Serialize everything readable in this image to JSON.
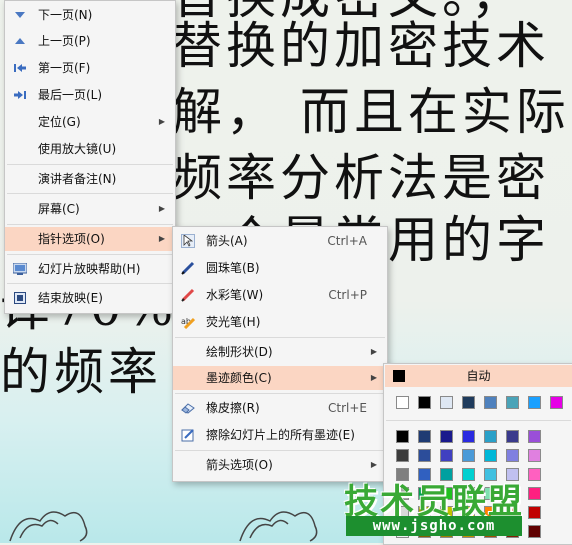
{
  "slide": {
    "lines": [
      "替换成密文。，",
      "替换的加密技术",
      "解， 而且在实际",
      "频率分析法是密",
      "一个最常用的字",
      "译70%    最现代",
      "的频率      根据统"
    ]
  },
  "main_menu": {
    "items": [
      {
        "label": "下一页(N)",
        "icon": "triangle-down-icon"
      },
      {
        "label": "上一页(P)",
        "icon": "triangle-up-icon"
      },
      {
        "label": "第一页(F)",
        "icon": "first-page-icon"
      },
      {
        "label": "最后一页(L)",
        "icon": "last-page-icon"
      },
      {
        "label": "定位(G)",
        "submenu": true
      },
      {
        "label": "使用放大镜(U)"
      },
      {
        "label": "演讲者备注(N)"
      },
      {
        "label": "屏幕(C)",
        "submenu": true
      },
      {
        "label": "指针选项(O)",
        "submenu": true,
        "highlighted": true
      },
      {
        "label": "幻灯片放映帮助(H)",
        "icon": "help-icon"
      },
      {
        "label": "结束放映(E)",
        "icon": "end-show-icon"
      }
    ]
  },
  "pointer_menu": {
    "items": [
      {
        "label": "箭头(A)",
        "shortcut": "Ctrl+A",
        "icon": "arrow-pointer-icon",
        "checked": true
      },
      {
        "label": "圆珠笔(B)",
        "icon": "ballpoint-pen-icon"
      },
      {
        "label": "水彩笔(W)",
        "shortcut": "Ctrl+P",
        "icon": "felt-pen-icon"
      },
      {
        "label": "荧光笔(H)",
        "icon": "highlighter-icon"
      },
      {
        "label": "绘制形状(D)",
        "submenu": true
      },
      {
        "label": "墨迹颜色(C)",
        "submenu": true,
        "highlighted": true
      },
      {
        "label": "橡皮擦(R)",
        "shortcut": "Ctrl+E",
        "icon": "eraser-icon"
      },
      {
        "label": "擦除幻灯片上的所有墨迹(E)",
        "icon": "erase-all-icon"
      },
      {
        "label": "箭头选项(O)",
        "submenu": true
      }
    ]
  },
  "color_menu": {
    "auto_label": "自动",
    "top_row": [
      "#ffffff",
      "#000000",
      "#dfe8f4",
      "#1f3b5c",
      "#4f81bd",
      "#4aa3b8",
      "#1aa0ff",
      "#e600e6"
    ],
    "grid": [
      [
        "#000000",
        "#1f3b73",
        "#1a1a8c",
        "#2a2ae0",
        "#2aa0c8",
        "#3a3a8c",
        "#9a4fd8"
      ],
      [
        "#3c3c3c",
        "#2c4d9a",
        "#4040c0",
        "#4a9ad8",
        "#00b8d8",
        "#8080e0",
        "#e080e0"
      ],
      [
        "#7f7f7f",
        "#3060c0",
        "#00a0a0",
        "#00d0d0",
        "#40c0e0",
        "#c0c0f0",
        "#ff60c0"
      ],
      [
        "#a6a6a6",
        "#00a050",
        "#20c020",
        "#60d860",
        "#80e0b0",
        "#f0a060",
        "#ff2080"
      ],
      [
        "#d9d9d9",
        "#a0a000",
        "#c0c000",
        "#ffd000",
        "#ff8000",
        "#ff2020",
        "#c00000"
      ],
      [
        "#f2f2f2",
        "#806000",
        "#a08000",
        "#c09000",
        "#a05000",
        "#802000",
        "#600000"
      ]
    ]
  },
  "watermark": {
    "logo_text": "技术员联盟",
    "url": "www.jsgho.com"
  }
}
